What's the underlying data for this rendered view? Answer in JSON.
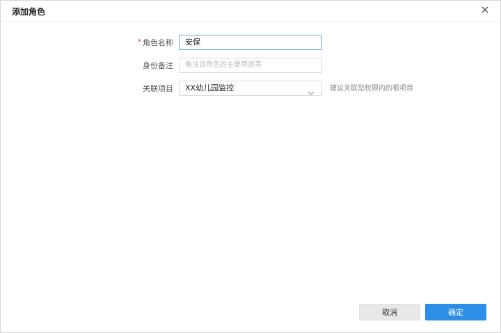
{
  "dialog": {
    "title": "添加角色",
    "close_icon": "close-icon"
  },
  "form": {
    "role_name": {
      "required_mark": "*",
      "label": "角色名称",
      "value": "安保"
    },
    "identity_note": {
      "label": "身份备注",
      "placeholder": "备注该角色的主要用途等"
    },
    "project": {
      "label": "关联项目",
      "selected": "XX幼儿园监控",
      "chevron_icon": "chevron-down-icon",
      "hint": "建议关联您权限内的根项目"
    }
  },
  "footer": {
    "cancel_label": "取消",
    "confirm_label": "确定"
  },
  "colors": {
    "primary": "#2d8ee8",
    "required": "#e03c31",
    "active_border": "#5aa5e8"
  }
}
